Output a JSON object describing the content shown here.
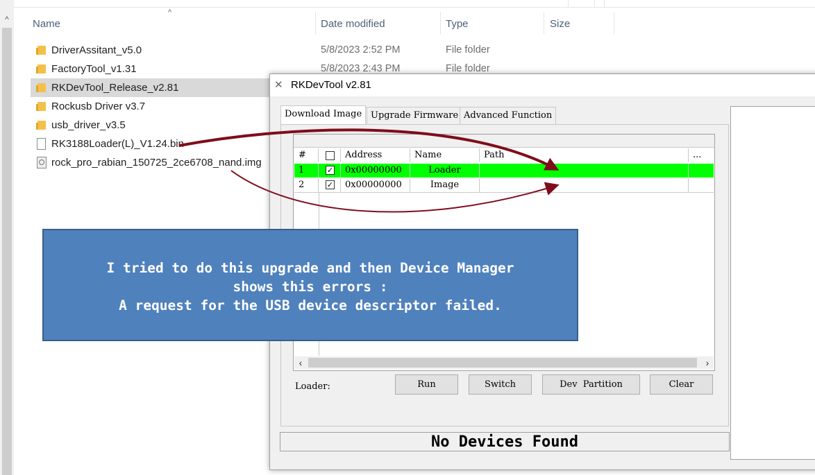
{
  "explorer": {
    "columns": {
      "name": "Name",
      "date_modified": "Date modified",
      "type": "Type",
      "size": "Size"
    },
    "sort_indicator": "^",
    "files": [
      {
        "name": "DriverAssitant_v5.0",
        "date": "5/8/2023 2:52 PM",
        "type": "File folder",
        "icon": "folder-icon"
      },
      {
        "name": "FactoryTool_v1.31",
        "date": "5/8/2023 2:43 PM",
        "type": "File folder",
        "icon": "folder-icon"
      },
      {
        "name": "RKDevTool_Release_v2.81",
        "date": "",
        "type": "",
        "icon": "folder-icon",
        "selected": true
      },
      {
        "name": "Rockusb Driver v3.7",
        "date": "",
        "type": "",
        "icon": "folder-icon"
      },
      {
        "name": "usb_driver_v3.5",
        "date": "",
        "type": "",
        "icon": "folder-icon"
      },
      {
        "name": "RK3188Loader(L)_V1.24.bin",
        "date": "",
        "type": "",
        "icon": "file-icon"
      },
      {
        "name": "rock_pro_rabian_150725_2ce6708_nand.img",
        "date": "",
        "type": "",
        "icon": "disk-image-icon"
      }
    ]
  },
  "rkdevtool": {
    "title": "RKDevTool v2.81",
    "tabs": [
      "Download Image",
      "Upgrade Firmware",
      "Advanced Function"
    ],
    "grid": {
      "headers": {
        "num": "#",
        "check": "",
        "address": "Address",
        "name": "Name",
        "path": "Path",
        "more": "..."
      },
      "rows": [
        {
          "num": "1",
          "checked": true,
          "address": "0x00000000",
          "name": "Loader",
          "path": ""
        },
        {
          "num": "2",
          "checked": true,
          "address": "0x00000000",
          "name": "Image",
          "path": ""
        }
      ],
      "row_highlight_color": "#00ff00"
    },
    "loader_label": "Loader:",
    "buttons": {
      "run": "Run",
      "switch": "Switch",
      "dev_partition": "Dev  Partition",
      "clear": "Clear"
    },
    "status": "No Devices Found"
  },
  "callout": {
    "lines": [
      "I tried to do this upgrade and then Device Manager",
      "shows this errors :",
      "A request for the USB device descriptor failed."
    ],
    "background": "#4f81bd"
  },
  "annotation_arrow_color": "#7f0d1c"
}
